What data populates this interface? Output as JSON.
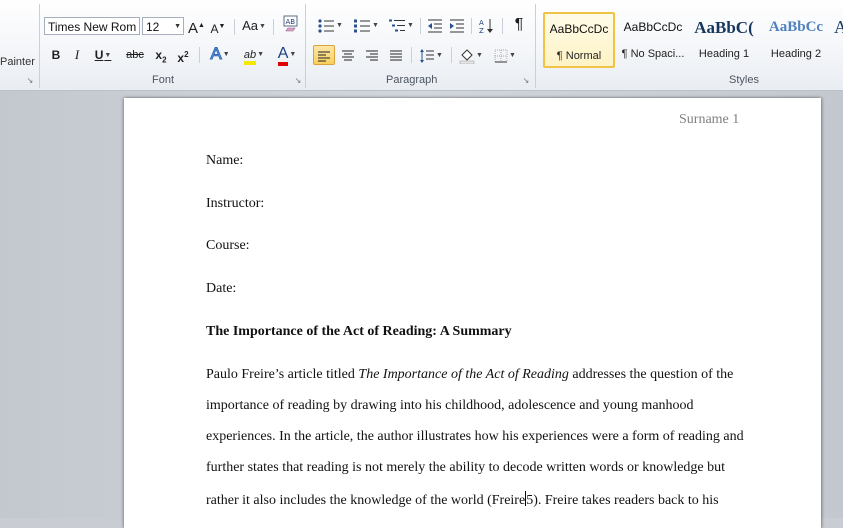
{
  "ribbon": {
    "clipboard": {
      "format_painter_label": "Painter"
    },
    "font": {
      "group_label": "Font",
      "font_name": "Times New Rom",
      "font_size": "12",
      "grow_font": "A",
      "shrink_font": "A",
      "change_case": "Aa",
      "clear_formatting": "AB",
      "bold": "B",
      "italic": "I",
      "underline": "U",
      "strikethrough": "abc",
      "subscript": "x",
      "subscript_mark": "2",
      "superscript": "x",
      "superscript_mark": "2",
      "text_effects": "A",
      "highlight": "ab",
      "font_color": "A"
    },
    "paragraph": {
      "group_label": "Paragraph",
      "show_marks": "¶"
    },
    "styles": {
      "group_label": "Styles",
      "items": [
        {
          "sample": "AaBbCcDc",
          "name": "¶ Normal"
        },
        {
          "sample": "AaBbCcDc",
          "name": "¶ No Spaci..."
        },
        {
          "sample": "AaBbC(",
          "name": "Heading 1"
        },
        {
          "sample": "AaBbCc",
          "name": "Heading 2"
        },
        {
          "sample": "A",
          "name": ""
        }
      ]
    },
    "colors": {
      "highlight": "#f5e700",
      "font_color": "#e00000",
      "heading": "#17365d",
      "heading2": "#4f81bd"
    }
  },
  "document": {
    "header": "Surname 1",
    "lines": {
      "name": "Name:",
      "instructor": "Instructor:",
      "course": "Course:",
      "date": "Date:",
      "title": "The Importance of the Act of Reading: A Summary"
    },
    "paragraph": {
      "line1_pre": "Paulo Freire’s article titled ",
      "line1_italic": "The Importance of the Act of Reading",
      "line1_post": " addresses the question of the",
      "line2": "importance of reading by drawing into his childhood, adolescence and young manhood",
      "line3": "experiences. In the article, the author illustrates how his experiences were a form of reading and",
      "line4": "further states that reading is not merely the ability to decode written words or knowledge but",
      "line5_pre": "rather it also includes the knowledge of the world (Freire",
      "line5_post": "5). Freire takes readers back to his"
    }
  }
}
